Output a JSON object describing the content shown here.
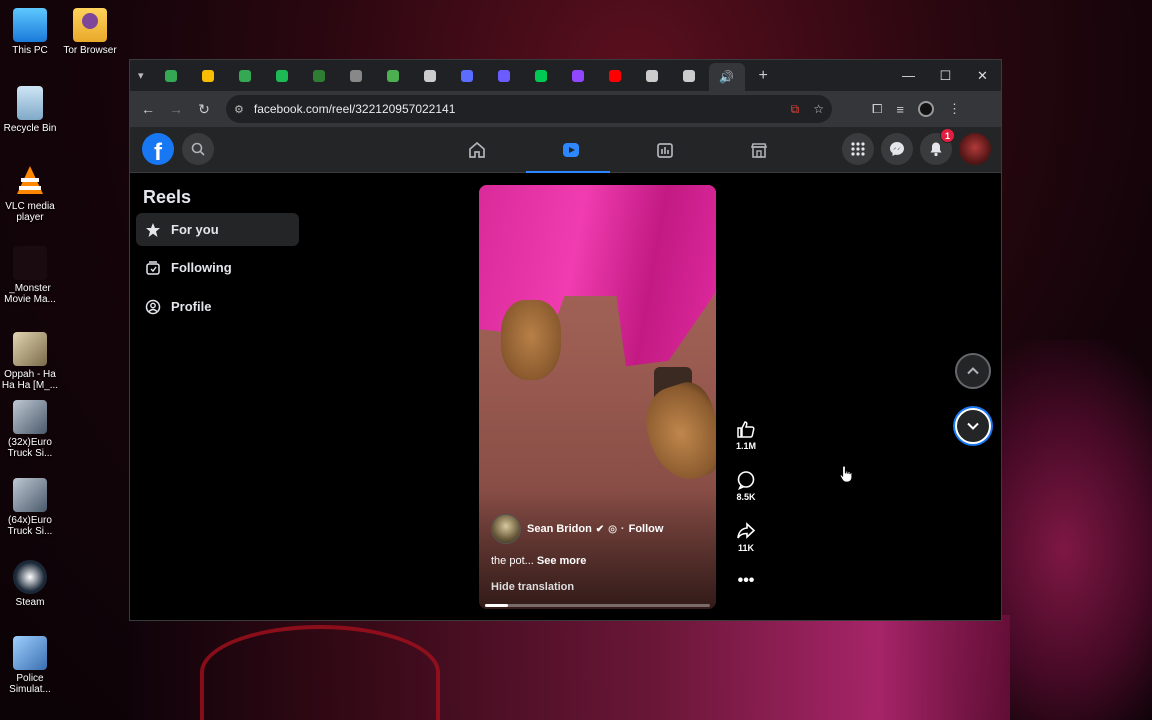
{
  "desktop": {
    "icons": [
      {
        "label": "This PC",
        "icon": "computer-icon"
      },
      {
        "label": "Tor Browser",
        "icon": "folder-icon"
      },
      {
        "label": "Recycle Bin",
        "icon": "recycle-bin-icon"
      },
      {
        "label": "VLC media player",
        "icon": "vlc-icon"
      },
      {
        "label": "_Monster Movie Ma...",
        "icon": "app-icon"
      },
      {
        "label": "Oppah - Ha Ha Ha [M_...",
        "icon": "media-file-icon"
      },
      {
        "label": "(32x)Euro Truck Si...",
        "icon": "game-shortcut-icon"
      },
      {
        "label": "(64x)Euro Truck Si...",
        "icon": "game-shortcut-icon"
      },
      {
        "label": "Steam",
        "icon": "steam-icon"
      },
      {
        "label": "Police Simulat...",
        "icon": "game-shortcut-icon"
      }
    ]
  },
  "browser": {
    "url": "facebook.com/reel/322120957022141",
    "tab_colors": [
      "#34a853",
      "#fbbc04",
      "#34a853",
      "#1db954",
      "#2e7d32",
      "#888888",
      "#4caf50",
      "#cccccc",
      "#5b6cff",
      "#6a5cff",
      "#00c853",
      "#9146ff",
      "#ff0000",
      "#cccccc",
      "#cccccc"
    ]
  },
  "facebook": {
    "notification_count": "1",
    "sidebar": {
      "title": "Reels",
      "items": [
        {
          "label": "For you",
          "icon": "star-icon",
          "selected": true
        },
        {
          "label": "Following",
          "icon": "following-icon",
          "selected": false
        },
        {
          "label": "Profile",
          "icon": "profile-icon",
          "selected": false
        }
      ]
    },
    "reel": {
      "author": "Sean Bridon",
      "follow": "Follow",
      "caption": "the pot...",
      "see_more": "See more",
      "hide_translation": "Hide translation",
      "progress_fraction": 0.1,
      "likes": "1.1M",
      "comments": "8.5K",
      "shares": "11K"
    }
  }
}
